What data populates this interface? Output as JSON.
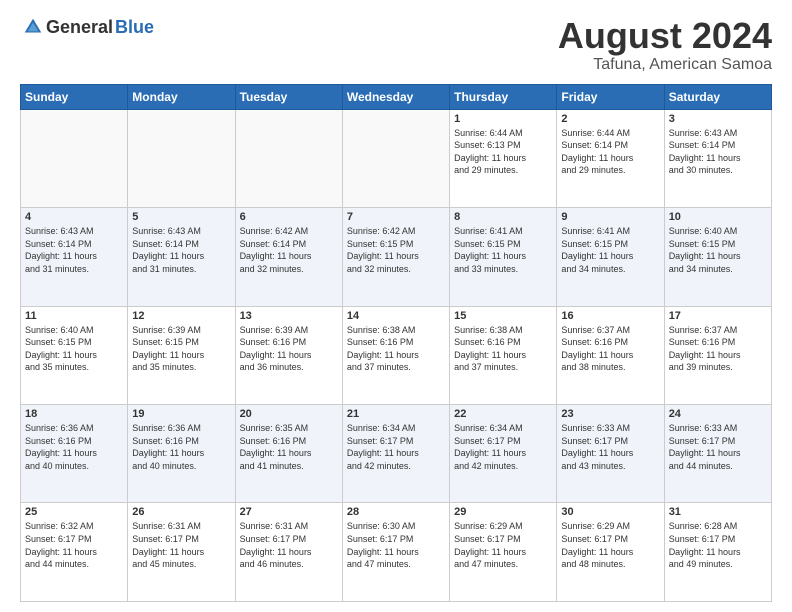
{
  "logo": {
    "general": "General",
    "blue": "Blue"
  },
  "title": "August 2024",
  "subtitle": "Tafuna, American Samoa",
  "days": [
    "Sunday",
    "Monday",
    "Tuesday",
    "Wednesday",
    "Thursday",
    "Friday",
    "Saturday"
  ],
  "weeks": [
    [
      {
        "num": "",
        "info": ""
      },
      {
        "num": "",
        "info": ""
      },
      {
        "num": "",
        "info": ""
      },
      {
        "num": "",
        "info": ""
      },
      {
        "num": "1",
        "info": "Sunrise: 6:44 AM\nSunset: 6:13 PM\nDaylight: 11 hours\nand 29 minutes."
      },
      {
        "num": "2",
        "info": "Sunrise: 6:44 AM\nSunset: 6:14 PM\nDaylight: 11 hours\nand 29 minutes."
      },
      {
        "num": "3",
        "info": "Sunrise: 6:43 AM\nSunset: 6:14 PM\nDaylight: 11 hours\nand 30 minutes."
      }
    ],
    [
      {
        "num": "4",
        "info": "Sunrise: 6:43 AM\nSunset: 6:14 PM\nDaylight: 11 hours\nand 31 minutes."
      },
      {
        "num": "5",
        "info": "Sunrise: 6:43 AM\nSunset: 6:14 PM\nDaylight: 11 hours\nand 31 minutes."
      },
      {
        "num": "6",
        "info": "Sunrise: 6:42 AM\nSunset: 6:14 PM\nDaylight: 11 hours\nand 32 minutes."
      },
      {
        "num": "7",
        "info": "Sunrise: 6:42 AM\nSunset: 6:15 PM\nDaylight: 11 hours\nand 32 minutes."
      },
      {
        "num": "8",
        "info": "Sunrise: 6:41 AM\nSunset: 6:15 PM\nDaylight: 11 hours\nand 33 minutes."
      },
      {
        "num": "9",
        "info": "Sunrise: 6:41 AM\nSunset: 6:15 PM\nDaylight: 11 hours\nand 34 minutes."
      },
      {
        "num": "10",
        "info": "Sunrise: 6:40 AM\nSunset: 6:15 PM\nDaylight: 11 hours\nand 34 minutes."
      }
    ],
    [
      {
        "num": "11",
        "info": "Sunrise: 6:40 AM\nSunset: 6:15 PM\nDaylight: 11 hours\nand 35 minutes."
      },
      {
        "num": "12",
        "info": "Sunrise: 6:39 AM\nSunset: 6:15 PM\nDaylight: 11 hours\nand 35 minutes."
      },
      {
        "num": "13",
        "info": "Sunrise: 6:39 AM\nSunset: 6:16 PM\nDaylight: 11 hours\nand 36 minutes."
      },
      {
        "num": "14",
        "info": "Sunrise: 6:38 AM\nSunset: 6:16 PM\nDaylight: 11 hours\nand 37 minutes."
      },
      {
        "num": "15",
        "info": "Sunrise: 6:38 AM\nSunset: 6:16 PM\nDaylight: 11 hours\nand 37 minutes."
      },
      {
        "num": "16",
        "info": "Sunrise: 6:37 AM\nSunset: 6:16 PM\nDaylight: 11 hours\nand 38 minutes."
      },
      {
        "num": "17",
        "info": "Sunrise: 6:37 AM\nSunset: 6:16 PM\nDaylight: 11 hours\nand 39 minutes."
      }
    ],
    [
      {
        "num": "18",
        "info": "Sunrise: 6:36 AM\nSunset: 6:16 PM\nDaylight: 11 hours\nand 40 minutes."
      },
      {
        "num": "19",
        "info": "Sunrise: 6:36 AM\nSunset: 6:16 PM\nDaylight: 11 hours\nand 40 minutes."
      },
      {
        "num": "20",
        "info": "Sunrise: 6:35 AM\nSunset: 6:16 PM\nDaylight: 11 hours\nand 41 minutes."
      },
      {
        "num": "21",
        "info": "Sunrise: 6:34 AM\nSunset: 6:17 PM\nDaylight: 11 hours\nand 42 minutes."
      },
      {
        "num": "22",
        "info": "Sunrise: 6:34 AM\nSunset: 6:17 PM\nDaylight: 11 hours\nand 42 minutes."
      },
      {
        "num": "23",
        "info": "Sunrise: 6:33 AM\nSunset: 6:17 PM\nDaylight: 11 hours\nand 43 minutes."
      },
      {
        "num": "24",
        "info": "Sunrise: 6:33 AM\nSunset: 6:17 PM\nDaylight: 11 hours\nand 44 minutes."
      }
    ],
    [
      {
        "num": "25",
        "info": "Sunrise: 6:32 AM\nSunset: 6:17 PM\nDaylight: 11 hours\nand 44 minutes."
      },
      {
        "num": "26",
        "info": "Sunrise: 6:31 AM\nSunset: 6:17 PM\nDaylight: 11 hours\nand 45 minutes."
      },
      {
        "num": "27",
        "info": "Sunrise: 6:31 AM\nSunset: 6:17 PM\nDaylight: 11 hours\nand 46 minutes."
      },
      {
        "num": "28",
        "info": "Sunrise: 6:30 AM\nSunset: 6:17 PM\nDaylight: 11 hours\nand 47 minutes."
      },
      {
        "num": "29",
        "info": "Sunrise: 6:29 AM\nSunset: 6:17 PM\nDaylight: 11 hours\nand 47 minutes."
      },
      {
        "num": "30",
        "info": "Sunrise: 6:29 AM\nSunset: 6:17 PM\nDaylight: 11 hours\nand 48 minutes."
      },
      {
        "num": "31",
        "info": "Sunrise: 6:28 AM\nSunset: 6:17 PM\nDaylight: 11 hours\nand 49 minutes."
      }
    ]
  ]
}
